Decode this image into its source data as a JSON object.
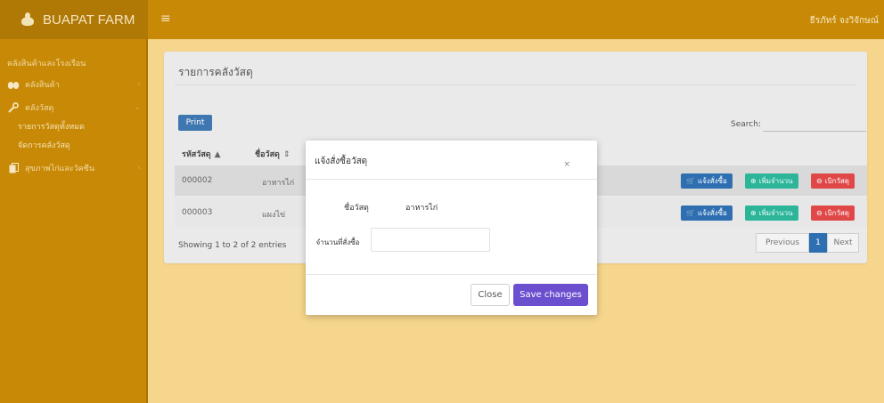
{
  "app": {
    "brand": "BUAPAT FARM",
    "menu_icon": "≡",
    "user": "ธีรภัทร์ จงวิจักษณ์"
  },
  "sidebar": {
    "header": "คลังสินค้าและโรงเรือน",
    "items": [
      {
        "label": "คลังสินค้า",
        "icon": "eggs-icon"
      },
      {
        "label": "คลังวัสดุ",
        "icon": "wrench-icon",
        "sub": [
          "รายการวัสดุทั้งหมด",
          "จัดการคลังวัสดุ"
        ]
      },
      {
        "label": "สุขภาพไก่และวัคซีน",
        "icon": "copy-icon"
      }
    ]
  },
  "card": {
    "title": "รายการคลังวัสดุ",
    "print_label": "Print",
    "search_label": "Search:",
    "columns": [
      "รหัสวัสดุ",
      "ชื่อวัสดุ"
    ],
    "rows": [
      {
        "code": "000002",
        "name": "อาหารไก่"
      },
      {
        "code": "000003",
        "name": "แผงไข่"
      }
    ],
    "actions": {
      "order": "แจ้งสั่งซื้อ",
      "add": "เพิ่มจำนวน",
      "withdraw": "เบิกวัสดุ"
    },
    "showing": "Showing 1 to 2 of 2 entries",
    "pager": {
      "previous": "Previous",
      "page": "1",
      "next": "Next"
    }
  },
  "modal": {
    "title": "แจ้งสั่งซื้อวัสดุ",
    "close_x": "×",
    "name_label": "ชื่อวัสดุ",
    "name_value": "อาหารไก่",
    "qty_label": "จำนวนที่สั่งซื้อ",
    "qty_value": "",
    "close_label": "Close",
    "save_label": "Save changes"
  },
  "colors": {
    "topbar": "#c88a06",
    "page_bg": "#f6d68c",
    "primary": "#2e6fb2",
    "teal": "#2db59a",
    "danger": "#e04848",
    "save": "#6b4fcf"
  }
}
